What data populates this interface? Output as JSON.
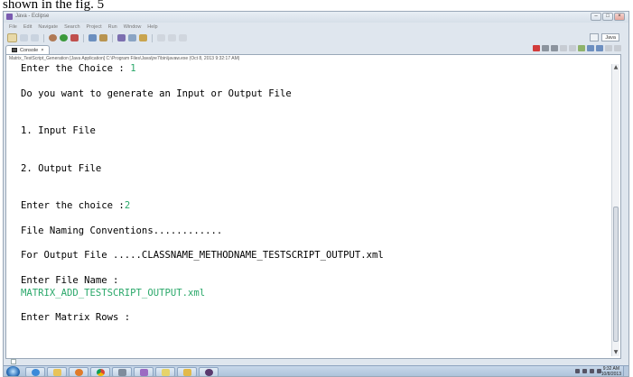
{
  "caption": "shown in the fig. 5",
  "window": {
    "title": "Java - Eclipse",
    "menu": [
      "File",
      "Edit",
      "Navigate",
      "Search",
      "Project",
      "Run",
      "Window",
      "Help"
    ],
    "perspective_label": "Java"
  },
  "console_tab": {
    "label": "Console",
    "description": "Matrix_TestScript_Generation [Java Application] C:\\Program Files\\Java\\jre7\\bin\\javaw.exe (Oct 8, 2013 9:32:17 AM)"
  },
  "console": {
    "lines": [
      {
        "text": "Enter the Choice : ",
        "input": "1"
      },
      {
        "text": "Do you want to generate an Input or Output File"
      },
      {
        "text": "1. Input File"
      },
      {
        "text": "2. Output File"
      },
      {
        "text": "Enter the choice :",
        "input": "2"
      },
      {
        "text": "File Naming Conventions............"
      },
      {
        "text": "For Output File .....CLASSNAME_METHODNAME_TESTSCRIPT_OUTPUT.xml"
      },
      {
        "text": "Enter File Name :"
      },
      {
        "text": "",
        "input": "MATRIX_ADD_TESTSCRIPT_OUTPUT.xml"
      },
      {
        "text": "Enter Matrix Rows :"
      }
    ]
  },
  "taskbar": {
    "time": "9:32 AM",
    "date": "10/8/2013"
  },
  "colors": {
    "user_input": "#2aa86a",
    "taskbar": "#b8cbe0"
  }
}
